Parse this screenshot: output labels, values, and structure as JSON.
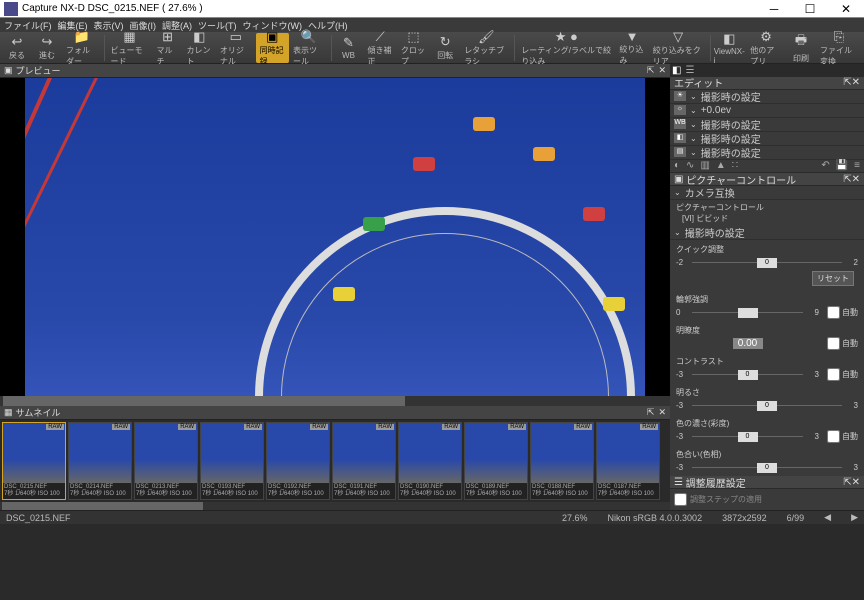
{
  "title": "Capture NX-D    DSC_0215.NEF ( 27.6% )",
  "menu": [
    "ファイル(F)",
    "編集(E)",
    "表示(V)",
    "画像(I)",
    "調整(A)",
    "ツール(T)",
    "ウィンドウ(W)",
    "ヘルプ(H)"
  ],
  "tools": {
    "back": "戻る",
    "forward": "進む",
    "folder": "フォルダー",
    "viewmode": "ビューモード",
    "multi": "マルチ",
    "current": "カレント",
    "original": "オリジナル",
    "compare": "同時記録",
    "display": "表示ツール",
    "wb": "WB",
    "distort": "傾き補正",
    "crop": "クロップ",
    "rotate": "回転",
    "retouch": "レタッチブラシ",
    "rating": "レーティング/ラベルで絞り込み",
    "filter": "絞り込み",
    "filterclear": "絞り込みをクリア",
    "viewnx": "ViewNX-i",
    "otherapp": "他のアプリ",
    "print": "印刷",
    "convert": "ファイル変換"
  },
  "preview_label": "プレビュー",
  "thumbnail_label": "サムネイル",
  "edit_label": "エディット",
  "adjustments": [
    {
      "icon": "☀",
      "label": "撮影時の設定"
    },
    {
      "icon": "☼",
      "label": "+0.0ev"
    },
    {
      "icon": "WB",
      "label": "撮影時の設定"
    },
    {
      "icon": "◧",
      "label": "撮影時の設定"
    },
    {
      "icon": "▤",
      "label": "撮影時の設定"
    }
  ],
  "picture_control": {
    "title": "ピクチャーコントロール",
    "camera_compat": "カメラ互換",
    "pc_label": "ピクチャーコントロール",
    "pc_value": "[VI] ビビッド",
    "shoot_setting": "撮影時の設定",
    "quick": "クイック調整",
    "reset": "リセット",
    "sliders": [
      {
        "name": "輪郭強調",
        "min": "0",
        "max": "9",
        "val": "",
        "auto": true
      },
      {
        "name": "明瞭度",
        "min": "",
        "max": "",
        "val": "0.00",
        "auto": true,
        "single": true
      },
      {
        "name": "コントラスト",
        "min": "-3",
        "max": "3",
        "val": "0",
        "auto": true
      },
      {
        "name": "明るさ",
        "min": "-3",
        "max": "3",
        "val": "0",
        "auto": false
      },
      {
        "name": "色の濃さ(彩度)",
        "min": "-3",
        "max": "3",
        "val": "0",
        "auto": true
      },
      {
        "name": "色合い(色相)",
        "min": "-3",
        "max": "3",
        "val": "0",
        "auto": false
      }
    ]
  },
  "history": {
    "title": "調整履歴設定",
    "apply": "調整ステップの適用"
  },
  "thumbnails": [
    {
      "name": "DSC_0215.NEF",
      "info": "7秒 1/640秒 ISO 100",
      "tag": "RAW",
      "sel": true
    },
    {
      "name": "DSC_0214.NEF",
      "info": "7秒 1/640秒 ISO 100",
      "tag": "RAW"
    },
    {
      "name": "DSC_0213.NEF",
      "info": "7秒 1/640秒 ISO 100",
      "tag": "RAW"
    },
    {
      "name": "DSC_0193.NEF",
      "info": "7秒 1/640秒 ISO 100",
      "tag": "RAW"
    },
    {
      "name": "DSC_0192.NEF",
      "info": "7秒 1/640秒 ISO 100",
      "tag": "RAW"
    },
    {
      "name": "DSC_0191.NEF",
      "info": "7秒 1/640秒 ISO 100",
      "tag": "RAW"
    },
    {
      "name": "DSC_0190.NEF",
      "info": "7秒 1/640秒 ISO 100",
      "tag": "RAW"
    },
    {
      "name": "DSC_0189.NEF",
      "info": "7秒 1/640秒 ISO 100",
      "tag": "RAW"
    },
    {
      "name": "DSC_0188.NEF",
      "info": "7秒 1/640秒 ISO 100",
      "tag": "RAW"
    },
    {
      "name": "DSC_0187.NEF",
      "info": "7秒 1/640秒 ISO 100",
      "tag": "RAW"
    }
  ],
  "status": {
    "file": "DSC_0215.NEF",
    "zoom": "27.6%",
    "profile": "Nikon sRGB 4.0.0.3002",
    "dims": "3872x2592",
    "pos": "6/99"
  },
  "auto_label": "自動",
  "quick_min": "-2",
  "quick_max": "2",
  "quick_val": "0"
}
